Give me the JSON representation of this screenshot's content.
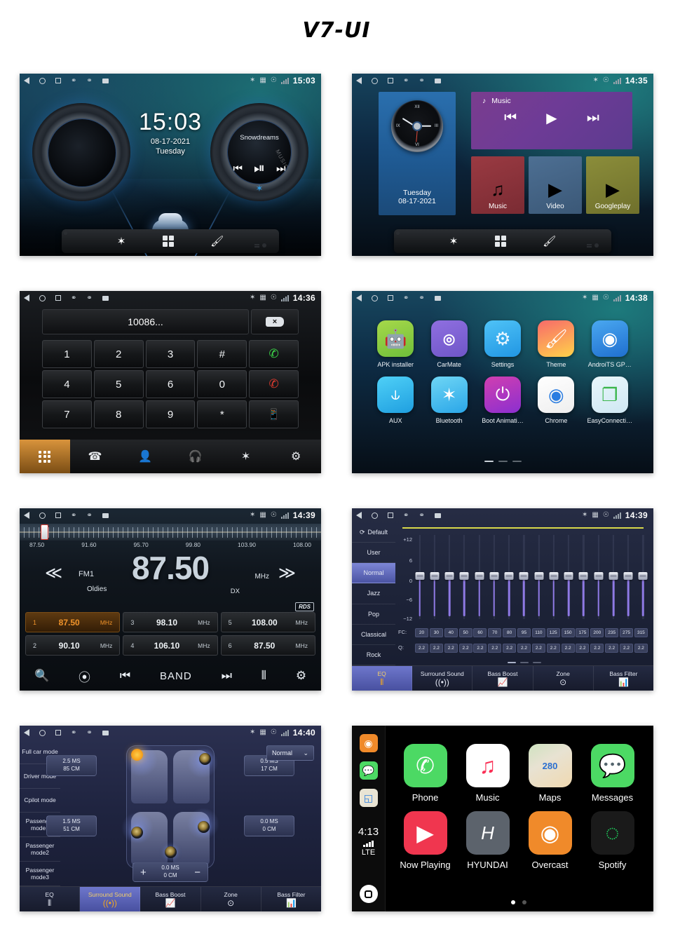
{
  "page": {
    "title": "V7-UI"
  },
  "statusbar": {
    "icons": [
      "back-icon",
      "home-icon",
      "recents-icon",
      "usb-icon",
      "usb-icon",
      "sdcard-icon",
      "bluetooth-icon",
      "battery-icon",
      "location-icon",
      "signal-icon"
    ]
  },
  "screens": [
    {
      "id": "home-dial",
      "time": "15:03",
      "clock": {
        "time": "15:03",
        "date": "08-17-2021",
        "weekday": "Tuesday"
      },
      "music": {
        "track": "Snowdreams",
        "watermark": "MUSIC",
        "prev": "⏮",
        "playpause": "⏯",
        "next": "⏭"
      },
      "dock": [
        {
          "name": "navigation",
          "icon": "location-pin-icon"
        },
        {
          "name": "bluetooth",
          "icon": "bluetooth-icon",
          "glyph": "✶"
        },
        {
          "name": "apps",
          "icon": "apps-grid-icon"
        },
        {
          "name": "theme",
          "icon": "paint-brush-icon",
          "glyph": "🖌"
        },
        {
          "name": "radio",
          "icon": "radio-icon"
        }
      ]
    },
    {
      "id": "home-tiles",
      "time": "14:35",
      "clock": {
        "weekday": "Tuesday",
        "date": "08-17-2021",
        "numerals": {
          "n12": "XII",
          "n3": "III",
          "n6": "VI",
          "n9": "IX"
        }
      },
      "music_widget": {
        "title": "Music",
        "note_icon": "music-note-icon",
        "prev": "⏮",
        "play": "▶",
        "next": "⏭"
      },
      "tiles": [
        {
          "label": "Music",
          "icon": "music-note-icon",
          "glyph": "♫",
          "color": "#9a3a42"
        },
        {
          "label": "Video",
          "icon": "video-clapper-icon",
          "glyph": "▶",
          "color": "#4d6f93"
        },
        {
          "label": "Googleplay",
          "icon": "google-play-icon",
          "glyph": "▶",
          "color": "#8b8d3a"
        }
      ]
    },
    {
      "id": "dialer",
      "time": "14:36",
      "display_value": "10086...",
      "delete_icon": "backspace-icon",
      "keys": [
        "1",
        "2",
        "3",
        "#",
        "call",
        "4",
        "5",
        "6",
        "0",
        "end",
        "7",
        "8",
        "9",
        "*",
        "transfer"
      ],
      "key_icons": {
        "call": "📞",
        "end": "📞",
        "transfer": "📱"
      },
      "navbar": [
        {
          "name": "keypad",
          "icon": "keypad-icon"
        },
        {
          "name": "call-log",
          "icon": "call-history-icon",
          "glyph": "✆"
        },
        {
          "name": "contacts",
          "icon": "contacts-book-icon",
          "glyph": "👤"
        },
        {
          "name": "bt-music",
          "icon": "bluetooth-headset-icon",
          "glyph": "🎧"
        },
        {
          "name": "bt-device",
          "icon": "bluetooth-phone-icon",
          "glyph": "✶"
        },
        {
          "name": "bt-settings",
          "icon": "bluetooth-settings-icon",
          "glyph": "⚙"
        }
      ]
    },
    {
      "id": "app-drawer",
      "time": "14:38",
      "apps": [
        {
          "label": "APK installer",
          "icon": "android-robot-icon",
          "glyph": "🤖",
          "bg": "linear-gradient(160deg,#a6d84a,#6fbf3a)",
          "fg": "#ffffff"
        },
        {
          "label": "CarMate",
          "icon": "carmate-icon",
          "glyph": "M",
          "bg": "linear-gradient(160deg,#8f6fe0,#6f56c8)",
          "fg": "#ffffff"
        },
        {
          "label": "Settings",
          "icon": "car-gear-icon",
          "glyph": "⚙",
          "bg": "linear-gradient(160deg,#4fc3f7,#2196e3)",
          "fg": "#e8f6ff"
        },
        {
          "label": "Theme",
          "icon": "paint-brush-icon",
          "glyph": "🖌",
          "bg": "linear-gradient(160deg,#f86a6a,#ffd24a)",
          "fg": "#ffffff"
        },
        {
          "label": "AndroiTS GP…",
          "icon": "gps-radar-icon",
          "glyph": "◉",
          "bg": "linear-gradient(160deg,#4aa8f0,#1f6fd0)",
          "fg": "#ffffff"
        },
        {
          "label": "AUX",
          "icon": "aux-jack-icon",
          "glyph": "⫽",
          "bg": "linear-gradient(160deg,#4fd0f7,#1f9fe0)",
          "fg": "#ffffff"
        },
        {
          "label": "Bluetooth",
          "icon": "bluetooth-icon",
          "glyph": "✶",
          "bg": "linear-gradient(160deg,#6fd6f5,#2aa6e8)",
          "fg": "#ffffff"
        },
        {
          "label": "Boot Animati…",
          "icon": "power-icon",
          "glyph": "⏻",
          "bg": "linear-gradient(160deg,#d13fb0,#8b2fd0)",
          "fg": "#ffffff"
        },
        {
          "label": "Chrome",
          "icon": "chrome-icon",
          "glyph": "◉",
          "bg": "linear-gradient(160deg,#ffffff,#eeeeee)",
          "fg": "#2a7de1"
        },
        {
          "label": "EasyConnecti…",
          "icon": "easyconnect-icon",
          "glyph": "❐",
          "bg": "linear-gradient(160deg,#e9f6fb,#cfe8f3)",
          "fg": "#39b54a"
        }
      ],
      "page_dots": 3,
      "active_dot": 0
    },
    {
      "id": "radio",
      "time": "14:39",
      "band": "FM1",
      "frequency": "87.50",
      "unit": "MHz",
      "genre": "Oldies",
      "sensitivity": "DX",
      "rds": "RDS",
      "scale_labels": [
        "87.50",
        "91.60",
        "95.70",
        "99.80",
        "103.90",
        "108.00"
      ],
      "arrow_prev": "≪",
      "arrow_next": "≫",
      "presets": [
        {
          "index": "1",
          "value": "87.50",
          "unit": "MHz",
          "selected": true
        },
        {
          "index": "2",
          "value": "90.10",
          "unit": "MHz",
          "selected": false
        },
        {
          "index": "3",
          "value": "98.10",
          "unit": "MHz",
          "selected": false
        },
        {
          "index": "4",
          "value": "106.10",
          "unit": "MHz",
          "selected": false
        },
        {
          "index": "5",
          "value": "108.00",
          "unit": "MHz",
          "selected": false
        },
        {
          "index": "6",
          "value": "87.50",
          "unit": "MHz",
          "selected": false
        }
      ],
      "toolbar": [
        {
          "name": "search",
          "icon": "magnifier-icon",
          "glyph": "🔍"
        },
        {
          "name": "scan",
          "icon": "broadcast-icon",
          "glyph": "⦿"
        },
        {
          "name": "prev",
          "icon": "prev-track-icon",
          "glyph": "⏮"
        },
        {
          "name": "band",
          "icon": "band-label",
          "glyph": "BAND"
        },
        {
          "name": "next",
          "icon": "next-track-icon",
          "glyph": "⏭"
        },
        {
          "name": "equalizer",
          "icon": "equalizer-icon",
          "glyph": "⫼"
        },
        {
          "name": "settings",
          "icon": "gear-icon",
          "glyph": "⚙"
        }
      ]
    },
    {
      "id": "equalizer",
      "time": "14:39",
      "presets": [
        {
          "label": "Default",
          "icon": "refresh-icon",
          "selected": false
        },
        {
          "label": "User",
          "selected": false
        },
        {
          "label": "Normal",
          "selected": true
        },
        {
          "label": "Jazz",
          "selected": false
        },
        {
          "label": "Pop",
          "selected": false
        },
        {
          "label": "Classical",
          "selected": false
        },
        {
          "label": "Rock",
          "selected": false
        }
      ],
      "scale_labels": [
        "+12",
        "6",
        "0",
        "−6",
        "−12"
      ],
      "fc_label": "FC:",
      "q_label": "Q:",
      "fc_values": [
        "20",
        "30",
        "40",
        "50",
        "60",
        "70",
        "80",
        "95",
        "110",
        "125",
        "150",
        "175",
        "200",
        "235",
        "275",
        "315"
      ],
      "q_values": [
        "2.2",
        "2.2",
        "2.2",
        "2.2",
        "2.2",
        "2.2",
        "2.2",
        "2.2",
        "2.2",
        "2.2",
        "2.2",
        "2.2",
        "2.2",
        "2.2",
        "2.2",
        "2.2"
      ],
      "gain_values": [
        0,
        0,
        0,
        0,
        0,
        0,
        0,
        0,
        0,
        0,
        0,
        0,
        0,
        0,
        0,
        0
      ],
      "page_dots": 3,
      "active_dot": 0
    },
    {
      "id": "surround-sound",
      "time": "14:40",
      "modes": [
        "Full car mode",
        "Driver mode",
        "Cpilot mode",
        "Passenger mode1",
        "Passenger mode2",
        "Passenger mode3"
      ],
      "mode_select": {
        "value": "Normal",
        "chevron": "∨"
      },
      "delays": [
        {
          "position": "front-left",
          "ms": "2.5 MS",
          "cm": "85 CM"
        },
        {
          "position": "front-right",
          "ms": "0.5 MS",
          "cm": "17 CM"
        },
        {
          "position": "rear-left",
          "ms": "1.5 MS",
          "cm": "51 CM"
        },
        {
          "position": "rear-right",
          "ms": "0.0 MS",
          "cm": "0 CM"
        }
      ],
      "stepper": {
        "plus": "+",
        "minus": "−",
        "ms": "0.0 MS",
        "cm": "0 CM"
      }
    },
    {
      "id": "carplay",
      "time": "4:13",
      "network": "LTE",
      "sidebar_apps": [
        {
          "name": "overcast-mini",
          "glyph": "◉",
          "bg": "#f08a2a",
          "fg": "#ffffff"
        },
        {
          "name": "messages-mini",
          "glyph": "💬",
          "bg": "#4cd964",
          "fg": "#ffffff"
        },
        {
          "name": "maps-mini",
          "glyph": "◱",
          "bg": "#e9e4d4",
          "fg": "#2a7de1"
        }
      ],
      "apps": [
        {
          "label": "Phone",
          "icon": "phone-icon",
          "glyph": "📞",
          "bg": "#4cd964",
          "fg": "#ffffff"
        },
        {
          "label": "Music",
          "icon": "apple-music-icon",
          "glyph": "♫",
          "bg": "#ffffff",
          "fg": "#fa2f55"
        },
        {
          "label": "Maps",
          "icon": "apple-maps-icon",
          "glyph": "280",
          "bg": "#e8e2d2",
          "fg": "#2a6fd0"
        },
        {
          "label": "Messages",
          "icon": "messages-icon",
          "glyph": "💬",
          "bg": "#4cd964",
          "fg": "#ffffff"
        },
        {
          "label": "Now Playing",
          "icon": "now-playing-icon",
          "glyph": "▶",
          "bg": "#f0364f",
          "fg": "#ffffff"
        },
        {
          "label": "HYUNDAI",
          "icon": "hyundai-logo-icon",
          "glyph": "H",
          "bg": "#5c636c",
          "fg": "#ffffff"
        },
        {
          "label": "Overcast",
          "icon": "overcast-icon",
          "glyph": "◉",
          "bg": "#f08a2a",
          "fg": "#ffffff"
        },
        {
          "label": "Spotify",
          "icon": "spotify-icon",
          "glyph": "♬",
          "bg": "#1a1a1a",
          "fg": "#1ed760"
        }
      ],
      "page_dots": 2,
      "active_dot": 0,
      "home_icon": "carplay-home-icon"
    }
  ],
  "audio_tabs": [
    {
      "label": "EQ",
      "icon": "equalizer-icon",
      "glyph": "⫼"
    },
    {
      "label": "Surround Sound",
      "icon": "surround-waves-icon",
      "glyph": "((•))"
    },
    {
      "label": "Bass Boost",
      "icon": "bass-chart-icon",
      "glyph": "📈"
    },
    {
      "label": "Zone",
      "icon": "zone-target-icon",
      "glyph": "⊙"
    },
    {
      "label": "Bass Filter",
      "icon": "bass-filter-icon",
      "glyph": "📊"
    }
  ]
}
